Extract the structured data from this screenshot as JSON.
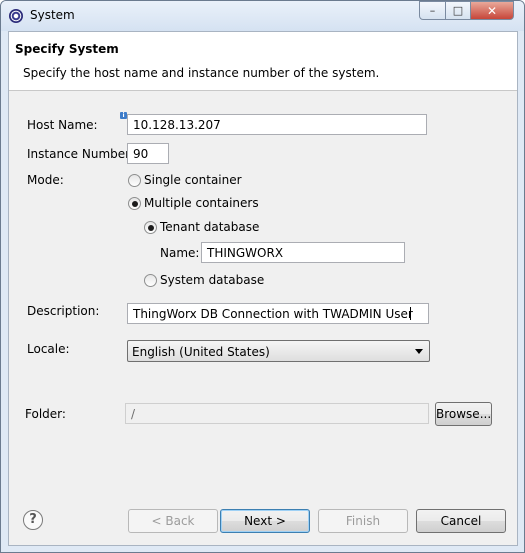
{
  "window": {
    "title": "System",
    "controls": {
      "minimize": "–",
      "maximize": "□",
      "close": "✕"
    }
  },
  "header": {
    "title": "Specify System",
    "description": "Specify the host name and instance number of the system."
  },
  "form": {
    "host_name": {
      "label": "Host Name:",
      "value": "10.128.13.207",
      "info_badge": "i"
    },
    "instance_number": {
      "label": "Instance Number:",
      "value": "90"
    },
    "mode": {
      "label": "Mode:",
      "single_container": {
        "label": "Single container",
        "selected": false
      },
      "multiple_containers": {
        "label": "Multiple containers",
        "selected": true
      },
      "tenant_database": {
        "label": "Tenant database",
        "selected": true
      },
      "tenant_name": {
        "label": "Name:",
        "value": "THINGWORX"
      },
      "system_database": {
        "label": "System database",
        "selected": false
      }
    },
    "description": {
      "label": "Description:",
      "value": "ThingWorx DB Connection with TWADMIN User"
    },
    "locale": {
      "label": "Locale:",
      "selected": "English (United States)"
    },
    "folder": {
      "label": "Folder:",
      "value": "/",
      "browse_label": "Browse..."
    }
  },
  "footer": {
    "help_icon": "?",
    "back_label": "< Back",
    "next_label": "Next >",
    "finish_label": "Finish",
    "cancel_label": "Cancel"
  }
}
